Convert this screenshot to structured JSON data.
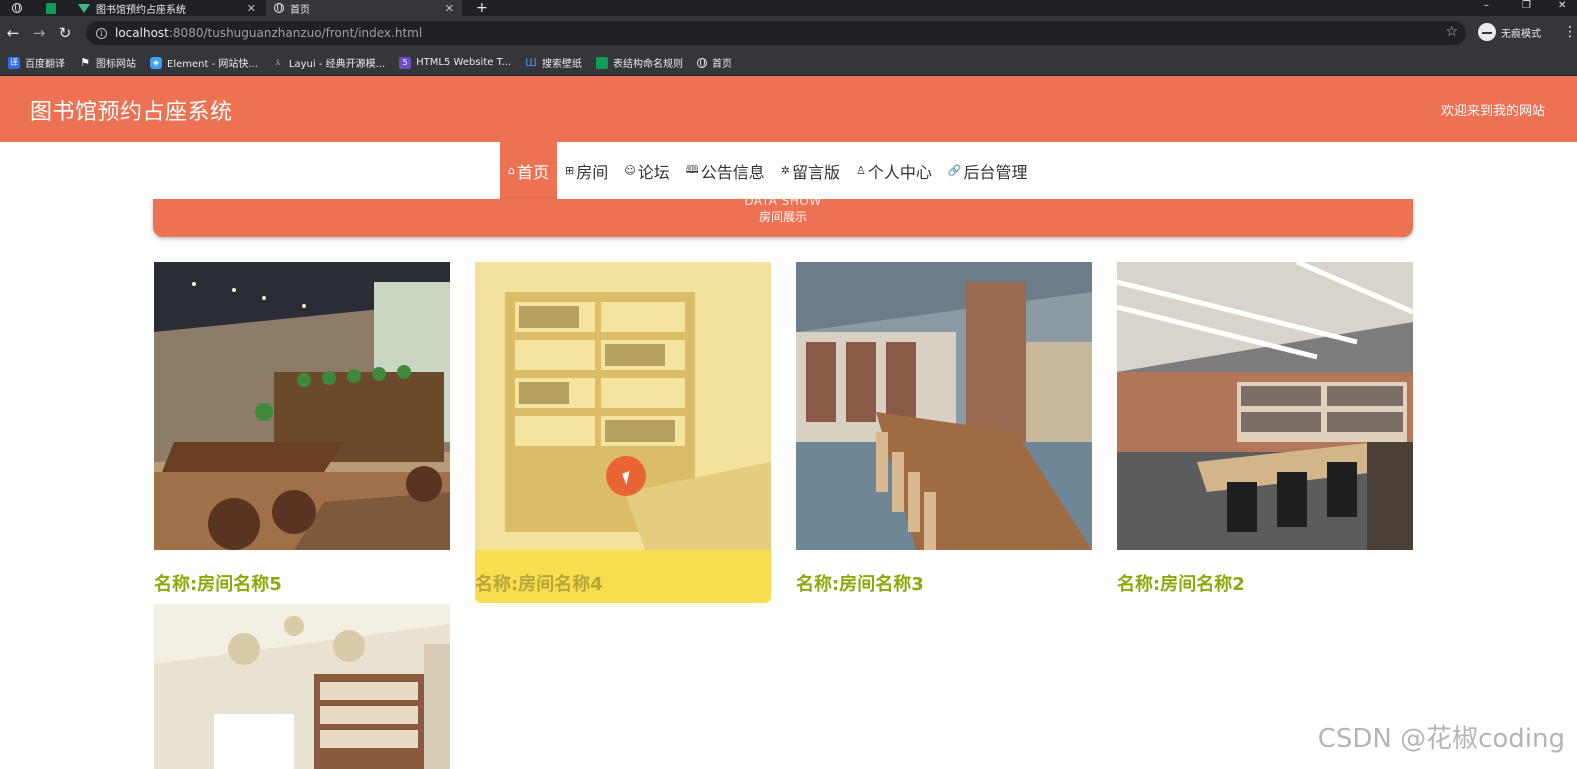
{
  "browser": {
    "tabs": [
      {
        "title": "",
        "icon": "globe-icon"
      },
      {
        "title": "",
        "icon": "sheet-icon"
      },
      {
        "title": "图书馆预约占座系统",
        "icon": "vue-icon"
      },
      {
        "title": "首页",
        "icon": "globe-icon"
      }
    ],
    "new_tab": "+",
    "url_host": "localhost",
    "url_rest": ":8080/tushuguanzhanzuo/front/index.html",
    "incognito_label": "无痕模式",
    "bookmarks": [
      {
        "label": "百度翻译",
        "icon": "translate-icon",
        "color": "#2b6de5"
      },
      {
        "label": "图标网站",
        "icon": "flag-icon",
        "color": "#ffffff"
      },
      {
        "label": "Element - 网站快...",
        "icon": "element-icon",
        "color": "#409eff"
      },
      {
        "label": "Layui - 经典开源模...",
        "icon": "layui-icon",
        "color": "#888888"
      },
      {
        "label": "HTML5 Website T...",
        "icon": "html5-icon",
        "color": "#6c4cc9"
      },
      {
        "label": "搜索壁纸",
        "icon": "wallpaper-icon",
        "color": "#4c8bf5"
      },
      {
        "label": "表结构命名规则",
        "icon": "sheet-icon",
        "color": "#0f9d58"
      },
      {
        "label": "首页",
        "icon": "globe-icon",
        "color": "#e8eaed"
      }
    ]
  },
  "header": {
    "title": "图书馆预约占座系统",
    "welcome": "欢迎来到我的网站"
  },
  "nav": [
    {
      "label": "首页",
      "icon": "home-icon",
      "glyph": "⌂",
      "active": true
    },
    {
      "label": "房间",
      "icon": "room-icon",
      "glyph": "⊞",
      "active": false
    },
    {
      "label": "论坛",
      "icon": "forum-icon",
      "glyph": "☺",
      "active": false
    },
    {
      "label": "公告信息",
      "icon": "notice-icon",
      "glyph": "🕮",
      "active": false
    },
    {
      "label": "留言版",
      "icon": "message-icon",
      "glyph": "✲",
      "active": false
    },
    {
      "label": "个人中心",
      "icon": "user-icon",
      "glyph": "♙",
      "active": false
    },
    {
      "label": "后台管理",
      "icon": "link-icon",
      "glyph": "🔗",
      "active": false
    }
  ],
  "section": {
    "en": "DATA SHOW",
    "zh": "房间展示"
  },
  "rooms": [
    {
      "name": "名称:房间名称5"
    },
    {
      "name": "名称:房间名称4"
    },
    {
      "name": "名称:房间名称3"
    },
    {
      "name": "名称:房间名称2"
    },
    {
      "name": ""
    }
  ],
  "watermark": "CSDN @花椒coding",
  "colors": {
    "brand": "#ed7153",
    "room_name": "#8fa80e",
    "hover_overlay": "#f7d730"
  }
}
